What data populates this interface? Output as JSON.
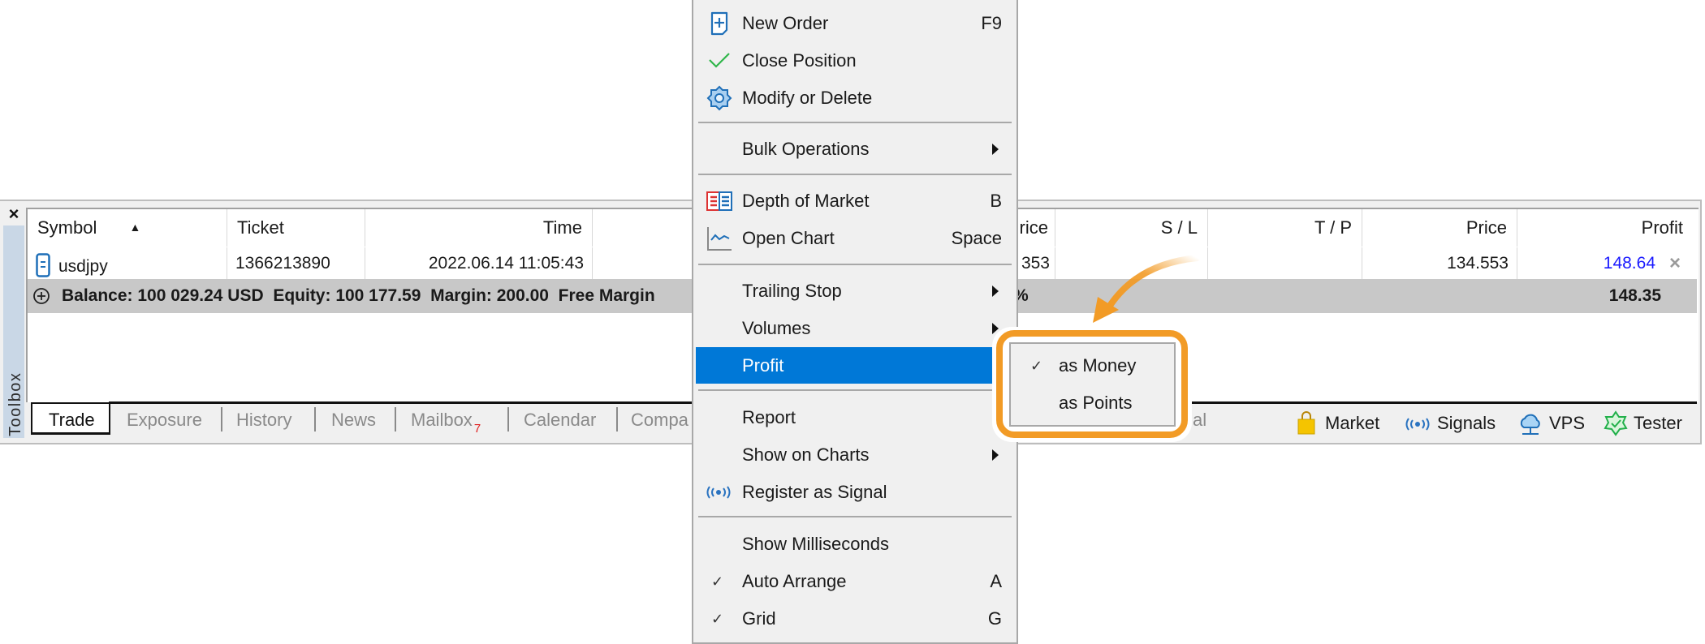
{
  "toolbox": {
    "label": "Toolbox",
    "close_icon": "×"
  },
  "grid": {
    "columns": [
      "Symbol",
      "Ticket",
      "Time",
      "rice",
      "S / L",
      "T / P",
      "Price",
      "Profit"
    ],
    "sort_indicator": "▲",
    "row": {
      "symbol": "usdjpy",
      "ticket": "1366213890",
      "time": "2022.06.14 11:05:43",
      "open_price_partial": "353",
      "sl": "",
      "tp": "",
      "price": "134.553",
      "profit": "148.64",
      "close_icon": "×"
    },
    "balance_row": {
      "text": "Balance: 100 029.24 USD  Equity: 100 177.59  Margin: 200.00  Free Margin",
      "percent_partial": "%",
      "total_profit": "148.35"
    }
  },
  "tabs": {
    "left": [
      {
        "label": "Trade",
        "active": true
      },
      {
        "label": "Exposure"
      },
      {
        "label": "History"
      },
      {
        "label": "News"
      },
      {
        "label": "Mailbox",
        "badge": "7"
      },
      {
        "label": "Calendar"
      },
      {
        "label": "Compa"
      }
    ],
    "partial_hidden": "al",
    "right": [
      {
        "label": "Market",
        "icon": "shopping-bag-icon"
      },
      {
        "label": "Signals",
        "icon": "signal-icon"
      },
      {
        "label": "VPS",
        "icon": "cloud-network-icon"
      },
      {
        "label": "Tester",
        "icon": "tester-star-icon"
      }
    ]
  },
  "context_menu": {
    "items": [
      {
        "label": "New Order",
        "shortcut": "F9",
        "icon": "new-order-icon"
      },
      {
        "label": "Close Position",
        "icon": "checkmark-icon"
      },
      {
        "label": "Modify or Delete",
        "icon": "gear-icon"
      },
      {
        "label": "Bulk Operations",
        "submenu": true
      },
      {
        "label": "Depth of Market",
        "shortcut": "B",
        "icon": "depth-of-market-icon"
      },
      {
        "label": "Open Chart",
        "shortcut": "Space",
        "icon": "chart-icon"
      },
      {
        "label": "Trailing Stop",
        "submenu": true
      },
      {
        "label": "Volumes",
        "submenu": true
      },
      {
        "label": "Profit",
        "submenu": true,
        "highlighted": true
      },
      {
        "label": "Report"
      },
      {
        "label": "Show on Charts",
        "submenu": true
      },
      {
        "label": "Register as Signal",
        "icon": "signal-icon"
      },
      {
        "label": "Show Milliseconds"
      },
      {
        "label": "Auto Arrange",
        "shortcut": "A",
        "checked": true
      },
      {
        "label": "Grid",
        "shortcut": "G",
        "checked": true
      }
    ],
    "check_glyph": "✓"
  },
  "profit_submenu": {
    "items": [
      {
        "label": "as Money",
        "checked": true
      },
      {
        "label": "as Points",
        "checked": false
      }
    ],
    "check_glyph": "✓"
  },
  "colors": {
    "highlight": "#0078d7",
    "annotation_orange": "#f29b26",
    "profit_blue": "#1a1aff"
  }
}
